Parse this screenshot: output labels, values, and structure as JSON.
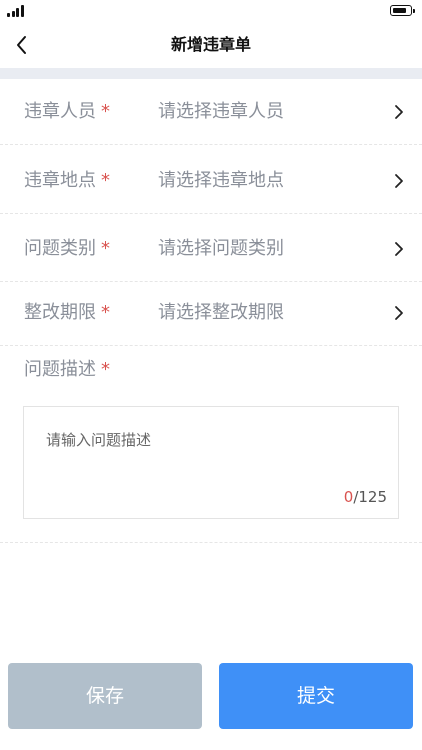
{
  "status_bar": {
    "battery_level": 0.85
  },
  "nav": {
    "title": "新增违章单"
  },
  "form": {
    "required_mark": "*",
    "rows": [
      {
        "label": "违章人员",
        "placeholder": "请选择违章人员"
      },
      {
        "label": "违章地点",
        "placeholder": "请选择违章地点"
      },
      {
        "label": "问题类别",
        "placeholder": "请选择问题类别"
      },
      {
        "label": "整改期限",
        "placeholder": "请选择整改期限"
      }
    ],
    "description": {
      "label": "问题描述",
      "placeholder": "请输入问题描述",
      "value": "",
      "count": "0",
      "max": "/125"
    }
  },
  "buttons": {
    "save_label": "保存",
    "submit_label": "提交"
  },
  "colors": {
    "accent": "#3f90f7",
    "disabled": "#b1bfcb",
    "required": "#d9534f",
    "band": "#e9ecf2"
  }
}
